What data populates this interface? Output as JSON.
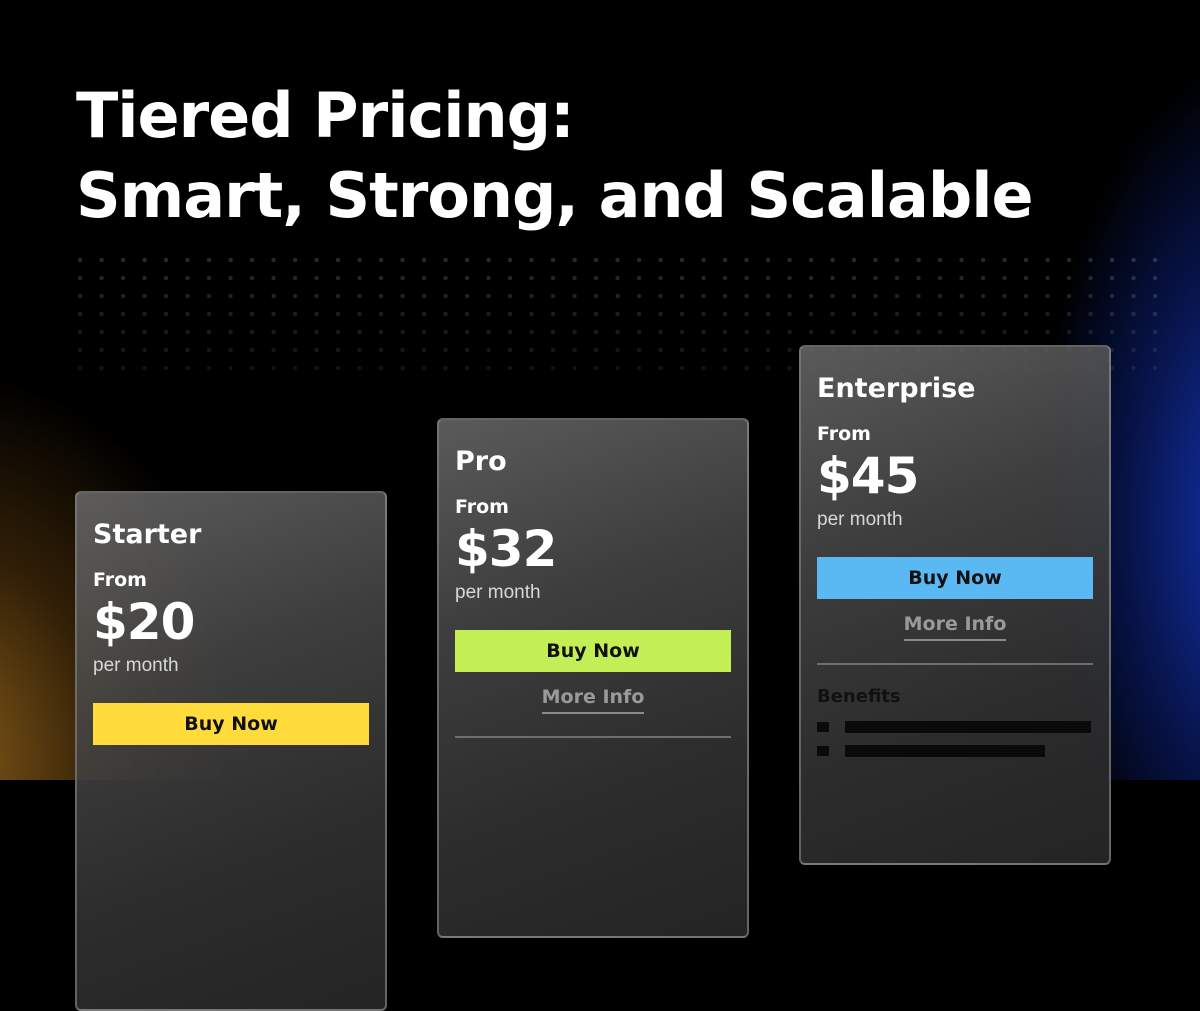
{
  "headline": {
    "line1": "Tiered Pricing:",
    "line2": "Smart, Strong, and Scalable"
  },
  "colors": {
    "starter_button": "#ffdc3c",
    "pro_button": "#c4ee55",
    "enterprise_button": "#5ab9f2",
    "glow_left": "#a06e1e",
    "glow_right": "#1436c8"
  },
  "plans": {
    "starter": {
      "name": "Starter",
      "from_label": "From",
      "price": "$20",
      "period": "per month",
      "buy_label": "Buy Now"
    },
    "pro": {
      "name": "Pro",
      "from_label": "From",
      "price": "$32",
      "period": "per month",
      "buy_label": "Buy Now",
      "more_label": "More Info"
    },
    "enterprise": {
      "name": "Enterprise",
      "from_label": "From",
      "price": "$45",
      "period": "per month",
      "buy_label": "Buy Now",
      "more_label": "More Info",
      "benefits_title": "Benefits"
    }
  }
}
